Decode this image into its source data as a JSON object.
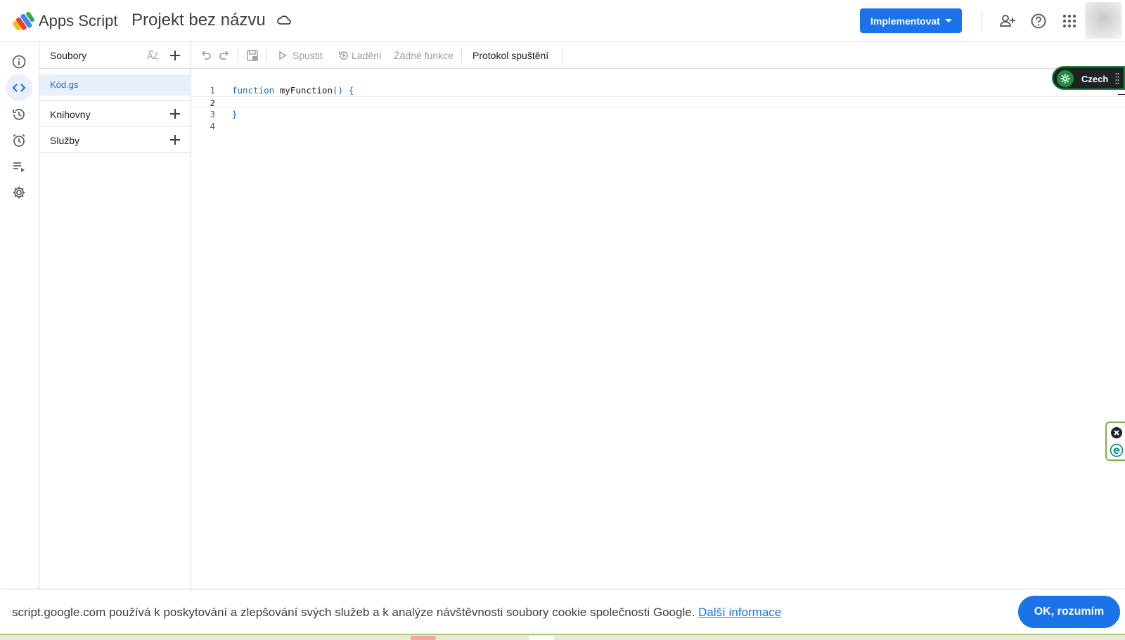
{
  "header": {
    "app_name": "Apps Script",
    "project_title": "Projekt bez názvu",
    "deploy_label": "Implementovat",
    "icons": [
      "apps-script-logo",
      "cloud-icon",
      "add-person-icon",
      "help-icon",
      "apps-grid-icon",
      "avatar"
    ]
  },
  "rail": {
    "items": [
      "info-icon",
      "code-icon",
      "history-icon",
      "alarm-icon",
      "executions-icon",
      "settings-icon"
    ],
    "active": "code-icon"
  },
  "files": {
    "title": "Soubory",
    "sort_label": "AZ",
    "items": [
      {
        "label": "Kód.gs"
      }
    ],
    "sections": [
      {
        "label": "Knihovny"
      },
      {
        "label": "Služby"
      }
    ]
  },
  "toolbar": {
    "run_label": "Spustit",
    "debug_label": "Ladění",
    "functions_label": "Žádné funkce",
    "log_label": "Protokol spuštění"
  },
  "editor": {
    "lines": [
      {
        "num": "1",
        "keyword": "function",
        "name": "myFunction",
        "punct": "() {"
      },
      {
        "num": "2"
      },
      {
        "num": "3",
        "punct": "}"
      },
      {
        "num": "4"
      }
    ]
  },
  "widget": {
    "language_label": "Czech"
  },
  "cookie": {
    "message": "script.google.com používá k poskytování a zlepšování svých služeb a k analýze návštěvnosti soubory cookie společnosti Google.",
    "link_label": "Další informace",
    "ok_label": "OK, rozumím"
  },
  "colors": {
    "accent": "#1a73e8",
    "active_bg": "#e8f0fe",
    "widget_green": "#1e8e3e"
  }
}
